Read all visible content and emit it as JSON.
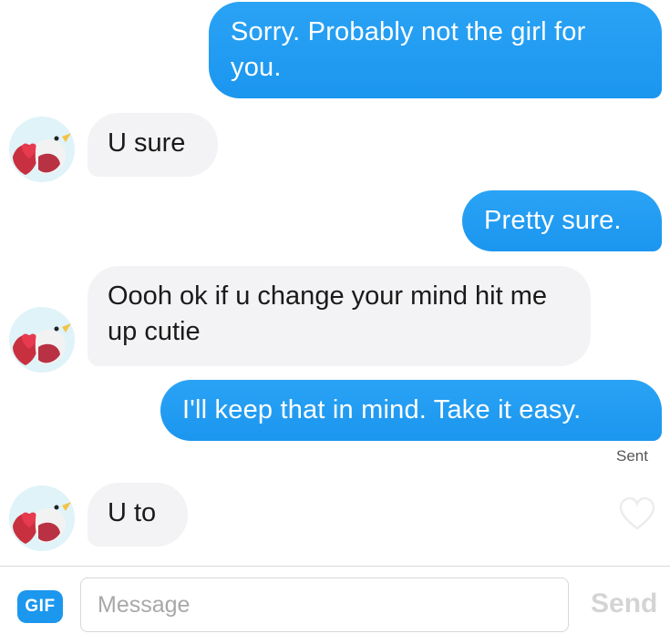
{
  "messages": [
    {
      "direction": "outgoing",
      "text": "Sorry. Probably not the girl for you."
    },
    {
      "direction": "incoming",
      "text": "U sure"
    },
    {
      "direction": "outgoing",
      "text": "Pretty sure."
    },
    {
      "direction": "incoming",
      "text": "Oooh ok if u change your mind hit me up cutie"
    },
    {
      "direction": "outgoing",
      "text": "I'll keep that in mind. Take it easy."
    },
    {
      "direction": "incoming",
      "text": "U to"
    }
  ],
  "status": {
    "sent_label": "Sent"
  },
  "composer": {
    "gif_label": "GIF",
    "placeholder": "Message",
    "send_label": "Send"
  },
  "colors": {
    "outgoing_bubble": "#1b96ef",
    "incoming_bubble": "#f3f3f5",
    "avatar_bg": "#dff3f8",
    "avatar_bird": "#e83a4f"
  },
  "icons": {
    "avatar": "bird-heart-avatar-icon",
    "like": "heart-outline-icon"
  }
}
